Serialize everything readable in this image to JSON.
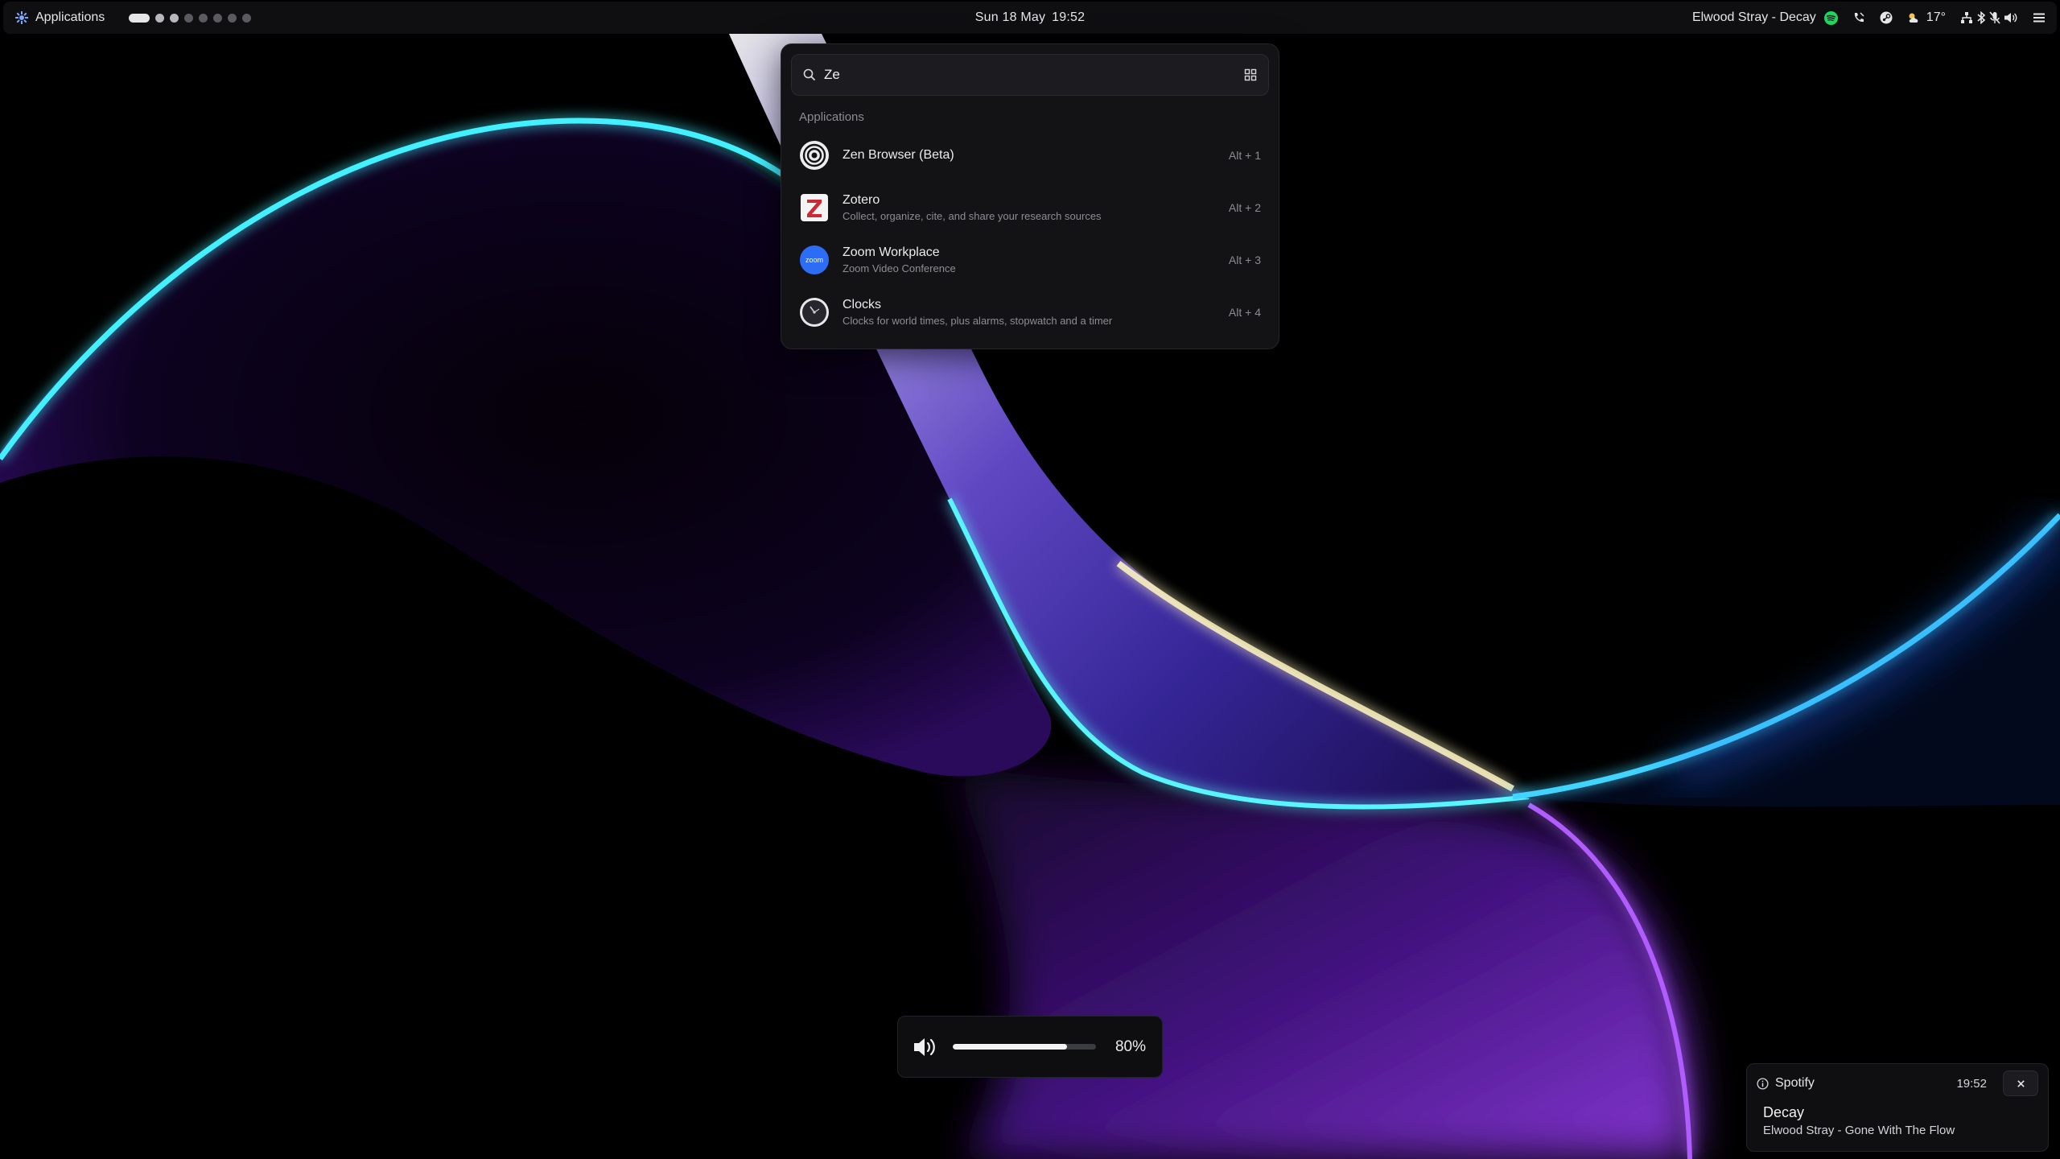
{
  "topbar": {
    "apps_label": "Applications",
    "workspaces": [
      "active",
      "occupied",
      "occupied",
      "empty",
      "empty",
      "empty",
      "empty",
      "empty"
    ],
    "date": "Sun 18 May",
    "time": "19:52",
    "now_playing": "Elwood Stray - Decay",
    "weather_temp": "17°",
    "icons": [
      "spotify-icon",
      "call-icon",
      "steam-icon",
      "weather-icon",
      "network-icon",
      "bluetooth-icon",
      "microphone-muted-icon",
      "volume-icon",
      "menu-icon"
    ]
  },
  "launcher": {
    "query": "Ze",
    "section": "Applications",
    "results": [
      {
        "name": "Zen Browser (Beta)",
        "description": "",
        "shortcut": "Alt + 1",
        "icon": "zen-browser-icon"
      },
      {
        "name": "Zotero",
        "description": "Collect, organize, cite, and share your research sources",
        "shortcut": "Alt + 2",
        "icon": "zotero-icon"
      },
      {
        "name": "Zoom Workplace",
        "description": "Zoom Video Conference",
        "shortcut": "Alt + 3",
        "icon": "zoom-icon"
      },
      {
        "name": "Clocks",
        "description": "Clocks for world times, plus alarms, stopwatch and a timer",
        "shortcut": "Alt + 4",
        "icon": "clocks-icon"
      }
    ],
    "zoom_icon_text": "zoom"
  },
  "volume_osd": {
    "value": "80%",
    "level": 0.8
  },
  "notification": {
    "app": "Spotify",
    "time": "19:52",
    "title": "Decay",
    "body": "Elwood Stray - Gone With The Flow"
  },
  "colors": {
    "spotify": "#1ed760",
    "zotero_red": "#cc2936",
    "zoom_blue": "#2d6df6",
    "accent_cyan": "#3ff0ff",
    "accent_purple": "#8a3df0"
  }
}
